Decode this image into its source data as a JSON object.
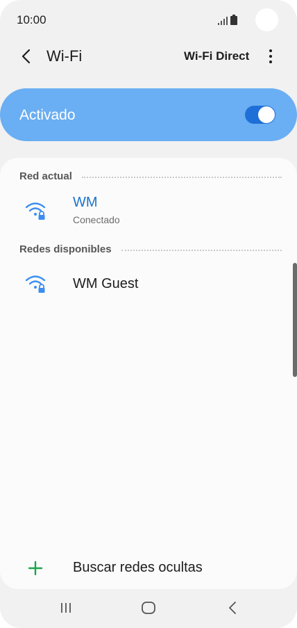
{
  "status_bar": {
    "time": "10:00",
    "signal_icon": "signal-bars-icon",
    "battery_icon": "battery-icon"
  },
  "header": {
    "back_icon": "chevron-left-icon",
    "title": "Wi-Fi",
    "wifi_direct_label": "Wi-Fi Direct",
    "more_icon": "more-vertical-icon"
  },
  "master_switch": {
    "label": "Activado",
    "enabled": true
  },
  "current_network": {
    "section_label": "Red actual",
    "name": "WM",
    "status": "Conectado",
    "icon": "wifi-lock-icon"
  },
  "available_networks": {
    "section_label": "Redes disponibles",
    "items": [
      {
        "name": "WM Guest",
        "icon": "wifi-lock-icon"
      }
    ]
  },
  "add_network": {
    "icon": "plus-icon",
    "label": "Buscar redes ocultas"
  },
  "nav_bar": {
    "recents_icon": "recents-icon",
    "home_icon": "home-icon",
    "back_icon": "back-icon"
  },
  "colors": {
    "accent": "#6aaef3",
    "toggle_on": "#1f6fd8",
    "connected_text": "#1a73c9",
    "wifi_icon": "#3b8ef0",
    "add_icon": "#1aa64a"
  }
}
